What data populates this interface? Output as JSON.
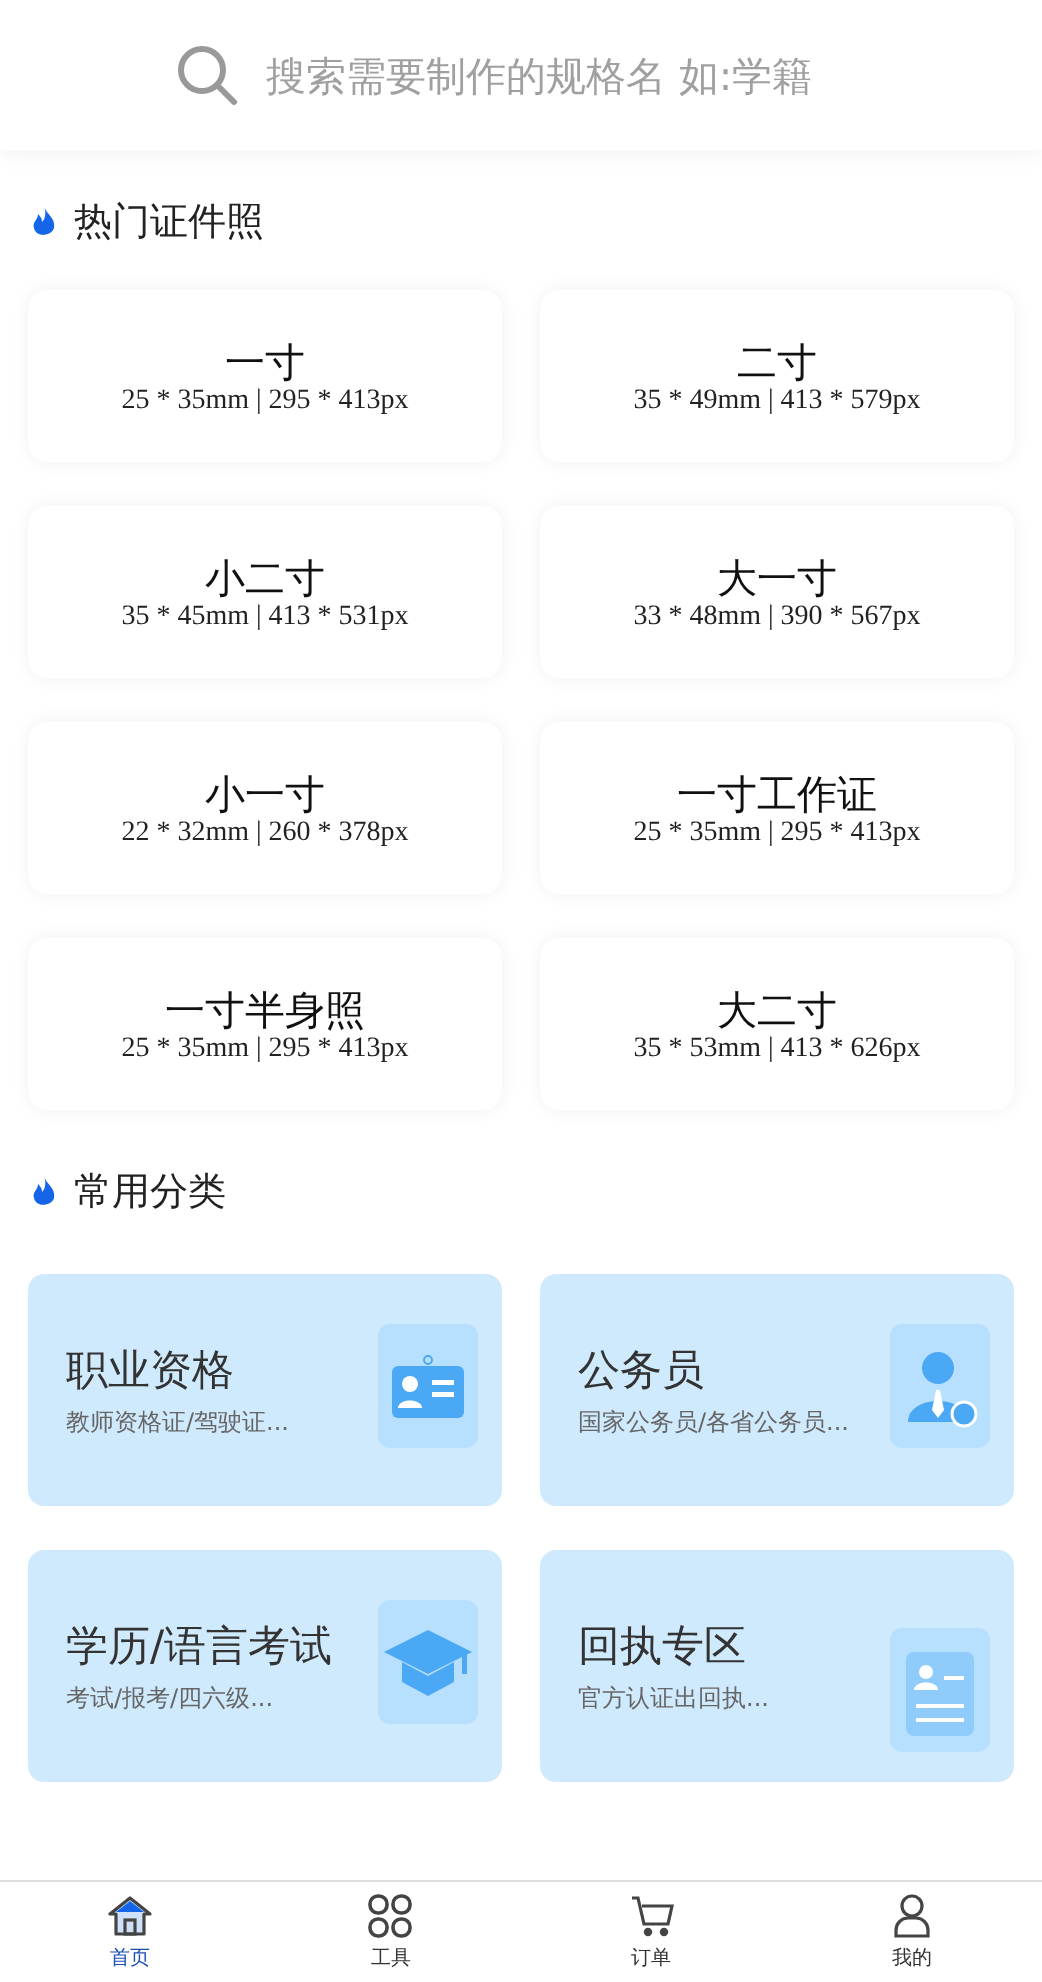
{
  "search": {
    "placeholder": "搜索需要制作的规格名 如:学籍"
  },
  "hot_section": {
    "title": "热门证件照"
  },
  "hot_sizes": [
    {
      "name": "一寸",
      "spec": "25 * 35mm | 295 * 413px"
    },
    {
      "name": "二寸",
      "spec": "35 * 49mm | 413 * 579px"
    },
    {
      "name": "小二寸",
      "spec": "35 * 45mm | 413 * 531px"
    },
    {
      "name": "大一寸",
      "spec": "33 * 48mm | 390 * 567px"
    },
    {
      "name": "小一寸",
      "spec": "22 * 32mm | 260 * 378px"
    },
    {
      "name": "一寸工作证",
      "spec": "25 * 35mm | 295 * 413px"
    },
    {
      "name": "一寸半身照",
      "spec": "25 * 35mm | 295 * 413px"
    },
    {
      "name": "大二寸",
      "spec": "35 * 53mm | 413 * 626px"
    }
  ],
  "category_section": {
    "title": "常用分类"
  },
  "categories": [
    {
      "kind": "badge",
      "title": "职业资格",
      "subtitle": "教师资格证/驾驶证..."
    },
    {
      "kind": "person",
      "title": "公务员",
      "subtitle": "国家公务员/各省公务员..."
    },
    {
      "kind": "cap",
      "title": "学历/语言考试",
      "subtitle": "考试/报考/四六级..."
    },
    {
      "kind": "receipt",
      "title": "回执专区",
      "subtitle": "官方认证出回执..."
    }
  ],
  "tab_bar": [
    {
      "kind": "home",
      "label": "首页",
      "selected": true
    },
    {
      "kind": "grid",
      "label": "工具",
      "selected": false
    },
    {
      "kind": "cart",
      "label": "订单",
      "selected": false
    },
    {
      "kind": "user",
      "label": "我的",
      "selected": false
    }
  ]
}
